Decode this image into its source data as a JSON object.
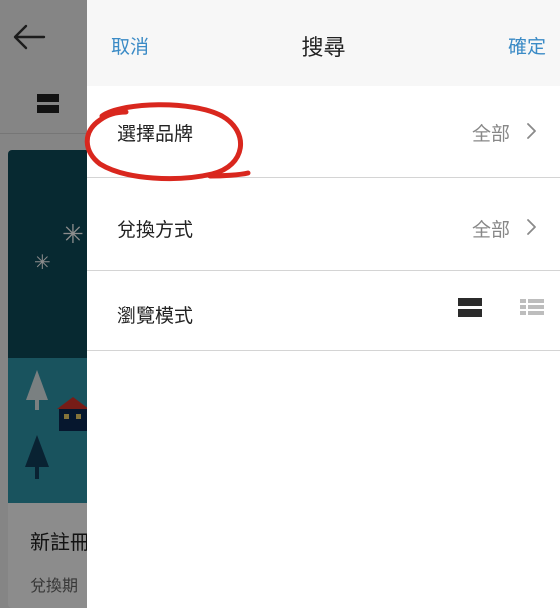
{
  "background": {
    "banner_title": "新註冊",
    "banner_subtitle": "兌換期"
  },
  "drawer": {
    "header": {
      "cancel_label": "取消",
      "title": "搜尋",
      "confirm_label": "確定"
    },
    "rows": {
      "brand": {
        "label": "選擇品牌",
        "value": "全部"
      },
      "redeem": {
        "label": "兌換方式",
        "value": "全部"
      },
      "browse": {
        "label": "瀏覽模式",
        "options": [
          "large-card-view",
          "list-view"
        ],
        "selected": "large-card-view"
      }
    }
  },
  "colors": {
    "accent": "#3b8bc6",
    "annotation": "#d9271e",
    "banner_dark": "#0d4b59",
    "banner_light": "#2f97ac"
  }
}
